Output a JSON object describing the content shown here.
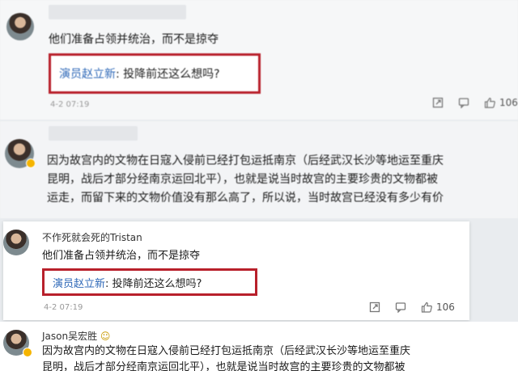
{
  "comments": [
    {
      "text": "他们准备占领并统治，而不是掠夺",
      "quote_author": "演员赵立新",
      "quote_text": ": 投降前还这么想吗?",
      "date": "4-2 07:19",
      "like_count": "106"
    },
    {
      "lines": [
        "因为故宫内的文物在日寇入侵前已经打包运抵南京（后经武汉长沙等地运至重庆",
        "昆明，战后才部分经南京运回北平），也就是说当时故宫的主要珍贵的文物都被",
        "运走，而留下来的文物价值没有那么高了，所以说，当时故宫已经没有多少有价"
      ]
    },
    {
      "username": "不作死就会死的Tristan",
      "text": "他们准备占领并统治，而不是掠夺",
      "quote_author": "演员赵立新",
      "quote_text": ": 投降前还这么想吗?",
      "date": "4-2 07:19",
      "like_count": "106"
    },
    {
      "username": "Jason吴宏胜",
      "username_emoji": "☺",
      "lines": [
        "因为故宫内的文物在日寇入侵前已经打包运抵南京（后经武汉长沙等地运至重庆",
        "昆明，战后才部分经南京运回北平），也就是说当时故宫的主要珍贵的文物都被"
      ]
    }
  ],
  "icons": {
    "share": "share-icon",
    "comment": "comment-icon",
    "like": "thumbs-up-icon"
  },
  "colors": {
    "highlight_border": "#b8202b",
    "quote_author": "#2f69b8",
    "verified_badge": "#f5b400"
  }
}
